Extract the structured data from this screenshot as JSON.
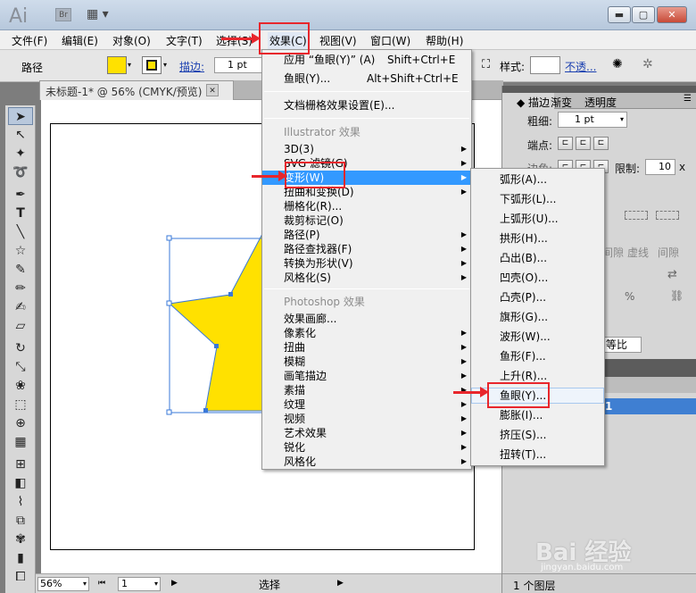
{
  "window": {
    "app_logo": "Ai",
    "bridge_logo": "Br",
    "minimize": "▬",
    "maximize": "▢",
    "close": "✕"
  },
  "menubar": {
    "items": [
      "文件(F)",
      "编辑(E)",
      "对象(O)",
      "文字(T)",
      "选择(S)",
      "效果(C)",
      "视图(V)",
      "窗口(W)",
      "帮助(H)"
    ]
  },
  "control_bar": {
    "object_type": "路径",
    "stroke_label": "描边:",
    "stroke_value": "1 pt",
    "style_label": "样式:",
    "opacity_label": "不透..."
  },
  "document": {
    "tab_title": "未标题-1* @ 56% (CMYK/预览)",
    "close": "✕"
  },
  "effects_menu": {
    "apply_last": {
      "label": "应用 “鱼眼(Y)” (A)",
      "shortcut": "Shift+Ctrl+E"
    },
    "last_effect": {
      "label": "鱼眼(Y)...",
      "shortcut": "Alt+Shift+Ctrl+E"
    },
    "raster_settings": "文档栅格效果设置(E)...",
    "illustrator_group": "Illustrator 效果",
    "illustrator_items": [
      "3D(3)",
      "SVG 滤镜(G)",
      "变形(W)",
      "扭曲和变换(D)",
      "栅格化(R)...",
      "裁剪标记(O)",
      "路径(P)",
      "路径查找器(F)",
      "转换为形状(V)",
      "风格化(S)"
    ],
    "photoshop_group": "Photoshop 效果",
    "photoshop_items": [
      "效果画廊...",
      "像素化",
      "扭曲",
      "模糊",
      "画笔描边",
      "素描",
      "纹理",
      "视频",
      "艺术效果",
      "锐化",
      "风格化"
    ]
  },
  "warp_submenu": {
    "items": [
      "弧形(A)...",
      "下弧形(L)...",
      "上弧形(U)...",
      "拱形(H)...",
      "凸出(B)...",
      "凹壳(O)...",
      "凸壳(P)...",
      "旗形(G)...",
      "波形(W)...",
      "鱼形(F)...",
      "上升(R)...",
      "鱼眼(Y)...",
      "膨胀(I)...",
      "挤压(S)...",
      "扭转(T)..."
    ]
  },
  "stroke_panel": {
    "tabs": [
      "描边",
      "渐变",
      "透明度"
    ],
    "weight_label": "粗细:",
    "weight_value": "1 pt",
    "cap_label": "端点:",
    "corner_label": "边角:",
    "limit_label": "限制:",
    "limit_value": "10",
    "unit_x": "x",
    "dash_labels": [
      "间隙",
      "虚线",
      "间隙"
    ],
    "percent_sign": "%",
    "scale_label": "等比"
  },
  "layers_panel": {
    "layer_number": "1",
    "count": "1 个图层"
  },
  "statusbar": {
    "zoom": "56%",
    "artboard": "1",
    "tool": "选择"
  },
  "watermark": {
    "brand": "Bai  经验",
    "url": "jingyan.baidu.com"
  },
  "colors": {
    "star_fill": "#ffe100",
    "highlight": "#3399ff",
    "annotation_red": "#e8262c"
  }
}
